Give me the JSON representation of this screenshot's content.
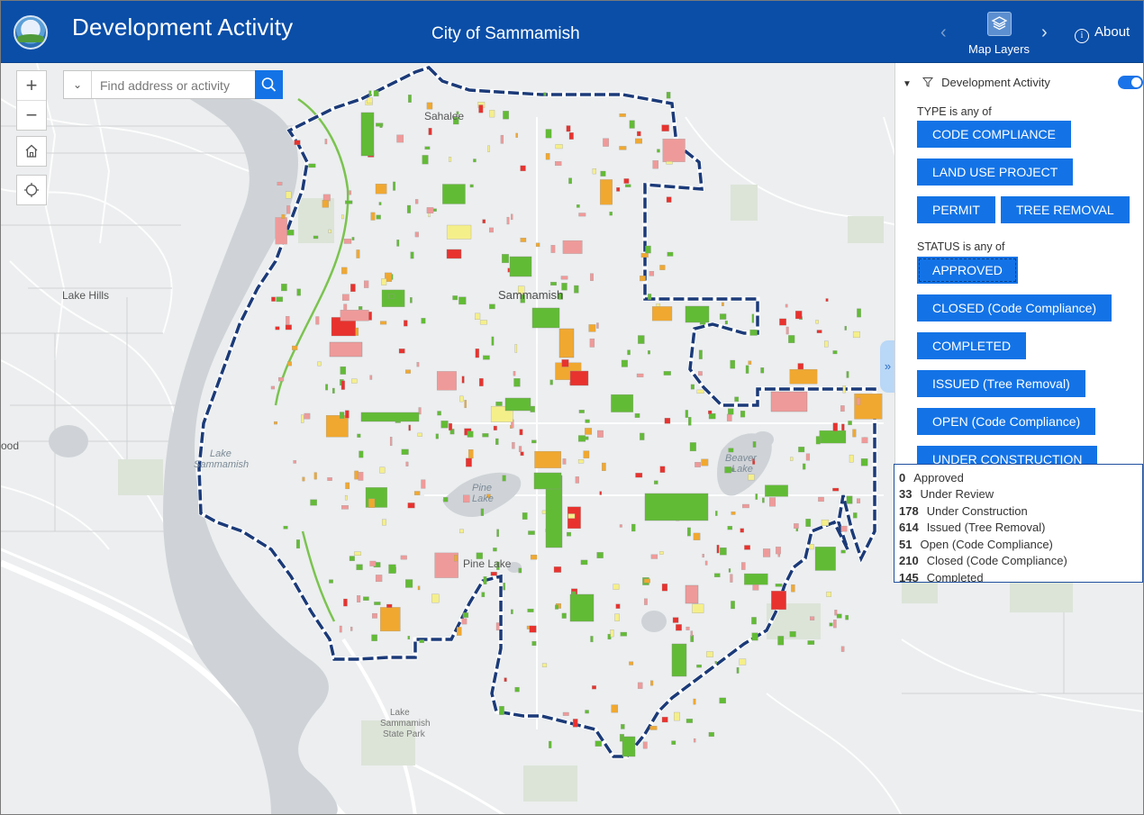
{
  "header": {
    "app_title": "Development Activity",
    "city_title": "City of Sammamish",
    "layers_label": "Map Layers",
    "about_label": "About",
    "background_color": "#0a4ea8"
  },
  "search": {
    "placeholder": "Find address or activity"
  },
  "map_labels": {
    "sahalee": "Sahalee",
    "sammamish": "Sammamish",
    "lake_hills": "Lake Hills",
    "lake_sammamish_1": "Lake",
    "lake_sammamish_2": "Sammamish",
    "beaver_lake_1": "Beaver",
    "beaver_lake_2": "Lake",
    "pine_lake_water": "Pine",
    "pine_lake_water_2": "Lake",
    "pine_lake": "Pine Lake",
    "wood": "ood",
    "state_park_1": "Lake",
    "state_park_2": "Sammamish",
    "state_park_3": "State Park"
  },
  "panel": {
    "layer_title": "Development Activity",
    "type_label": "TYPE is any of",
    "type_chips": [
      "CODE COMPLIANCE",
      "LAND USE PROJECT",
      "PERMIT",
      "TREE REMOVAL"
    ],
    "status_label": "STATUS is any of",
    "status_chips": [
      "APPROVED",
      "CLOSED (Code Compliance)",
      "COMPLETED",
      "ISSUED (Tree Removal)",
      "OPEN (Code Compliance)",
      "UNDER CONSTRUCTION"
    ],
    "chip_color": "#1373e6"
  },
  "legend": [
    {
      "count": "0",
      "label": "Approved"
    },
    {
      "count": "33",
      "label": "Under Review"
    },
    {
      "count": "178",
      "label": "Under Construction"
    },
    {
      "count": "614",
      "label": "Issued (Tree Removal)"
    },
    {
      "count": "51",
      "label": "Open (Code Compliance)"
    },
    {
      "count": "210",
      "label": "Closed (Code Compliance)"
    },
    {
      "count": "145",
      "label": "Completed"
    }
  ],
  "status_colors": {
    "issued": "#62bb35",
    "under_construction": "#f0a830",
    "open": "#e8322e",
    "closed": "#ef9a9a",
    "completed": "#f5ef8a",
    "boundary": "#1b3a78"
  },
  "icons": {
    "zoom_in": "plus-icon",
    "zoom_out": "minus-icon",
    "home": "home-icon",
    "locate": "locate-icon",
    "search": "search-icon",
    "layers": "layers-icon",
    "about": "info-icon",
    "filter": "filter-icon"
  }
}
